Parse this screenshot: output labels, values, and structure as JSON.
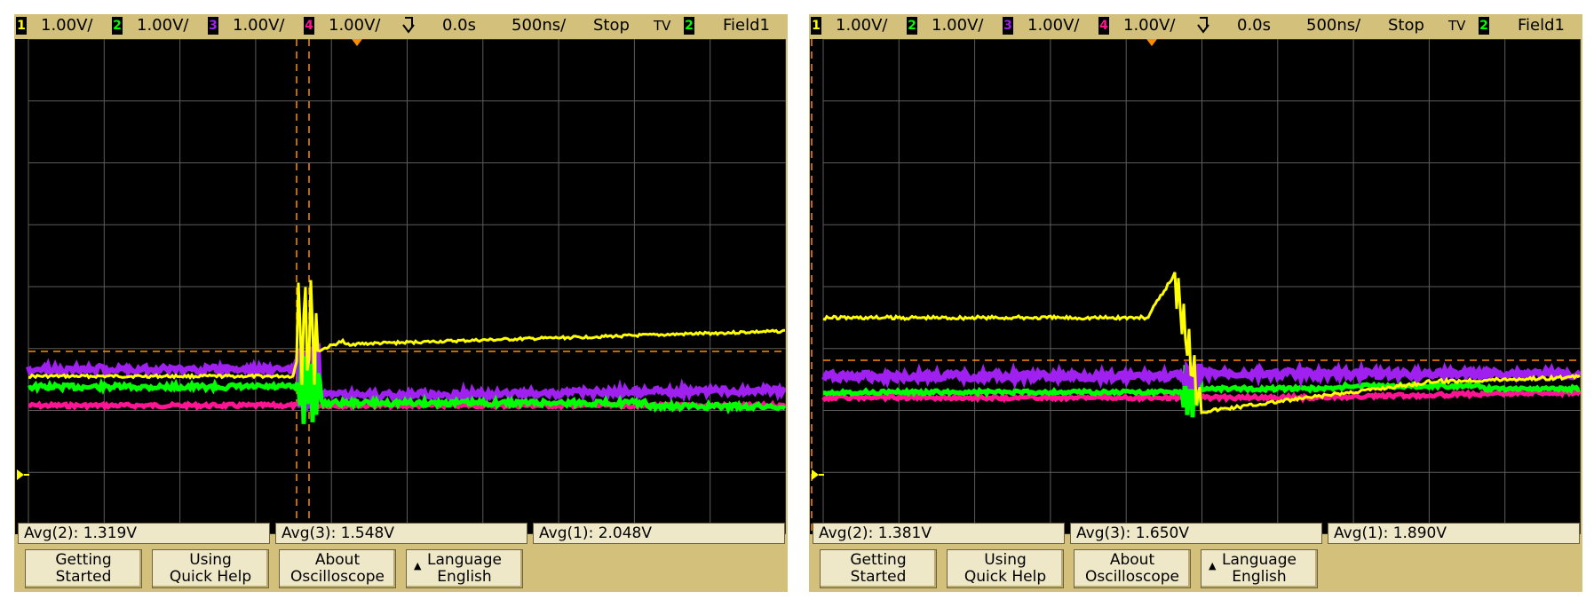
{
  "colors": {
    "bezel": "#d3c07a",
    "ch1": "#ffff00",
    "ch2": "#00ff00",
    "ch3": "#a020f0",
    "ch4": "#ff1493",
    "cursor": "#ff8c00",
    "grid": "#6b6b6b"
  },
  "scopes": [
    {
      "status": {
        "ch1_label": "1",
        "ch1_scale": "1.00V/",
        "ch2_label": "2",
        "ch2_scale": "1.00V/",
        "ch3_label": "3",
        "ch3_scale": "1.00V/",
        "ch4_label": "4",
        "ch4_scale": "1.00V/",
        "trigger_icon": "trigger-arrow-icon",
        "time_offset": "0.0s",
        "time_scale": "500ns/",
        "run_state": "Stop",
        "trigger_mode": "TV",
        "trigger_source": "2",
        "trigger_field": "Field1"
      },
      "measurements": [
        {
          "label": "Avg(2): 1.319V"
        },
        {
          "label": "Avg(3): 1.548V"
        },
        {
          "label": "Avg(1): 2.048V"
        }
      ],
      "softkeys": [
        {
          "line1": "Getting",
          "line2": "Started"
        },
        {
          "line1": "Using",
          "line2": "Quick Help"
        },
        {
          "line1": "About",
          "line2": "Oscilloscope"
        },
        {
          "line1": "Language",
          "line2": "English"
        }
      ]
    },
    {
      "status": {
        "ch1_label": "1",
        "ch1_scale": "1.00V/",
        "ch2_label": "2",
        "ch2_scale": "1.00V/",
        "ch3_label": "3",
        "ch3_scale": "1.00V/",
        "ch4_label": "4",
        "ch4_scale": "1.00V/",
        "trigger_icon": "trigger-arrow-icon",
        "time_offset": "0.0s",
        "time_scale": "500ns/",
        "run_state": "Stop",
        "trigger_mode": "TV",
        "trigger_source": "2",
        "trigger_field": "Field1"
      },
      "measurements": [
        {
          "label": "Avg(2): 1.381V"
        },
        {
          "label": "Avg(3): 1.650V"
        },
        {
          "label": "Avg(1): 1.890V"
        }
      ],
      "softkeys": [
        {
          "line1": "Getting",
          "line2": "Started"
        },
        {
          "line1": "Using",
          "line2": "Quick Help"
        },
        {
          "line1": "About",
          "line2": "Oscilloscope"
        },
        {
          "line1": "Language",
          "line2": "English"
        }
      ]
    }
  ]
}
